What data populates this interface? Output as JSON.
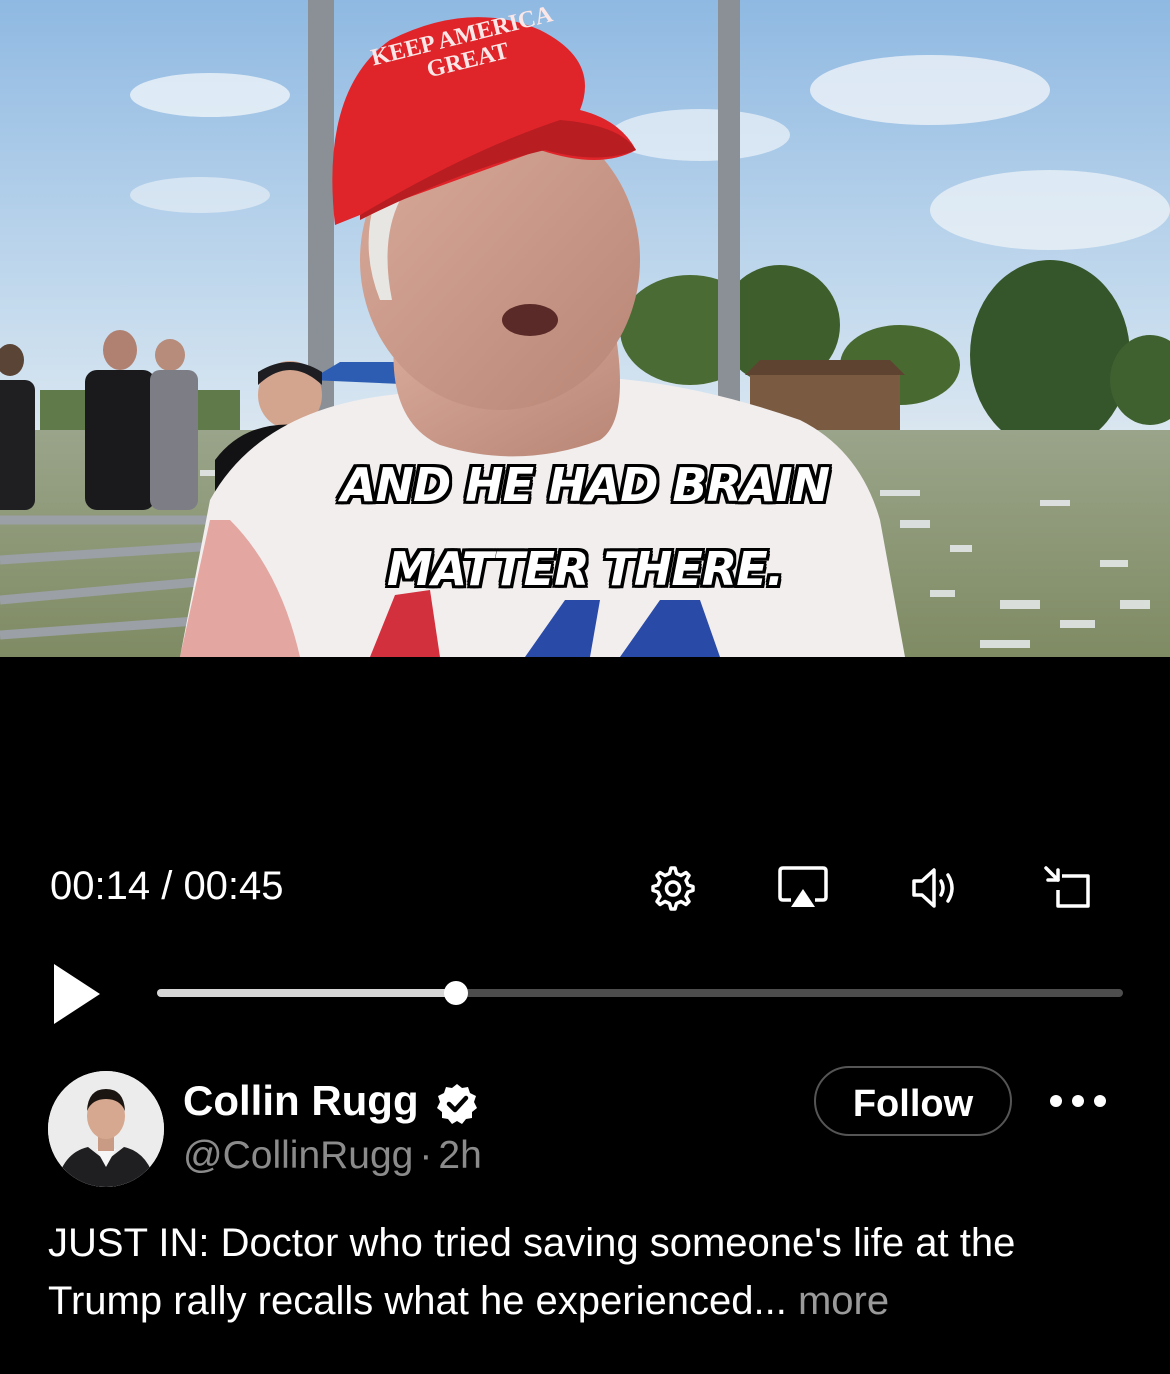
{
  "video": {
    "caption_line1": "AND HE HAD BRAIN",
    "caption_line2": "MATTER THERE.",
    "hat_text": "KEEP AMERICA GREAT",
    "progress": 0.31
  },
  "controls": {
    "time_display": "00:14 / 00:45",
    "icons": [
      "settings-icon",
      "airplay-icon",
      "volume-icon",
      "minimize-icon",
      "play-icon"
    ]
  },
  "post": {
    "author_name": "Collin Rugg",
    "handle": "@CollinRugg",
    "separator": "·",
    "age": "2h",
    "follow_label": "Follow",
    "text": "JUST IN: Doctor who tried saving someone's life at the Trump rally recalls what he experienced...",
    "more_label": "more"
  },
  "colors": {
    "background": "#000000",
    "hat_red": "#e0252a",
    "sky": "#a9c9e8",
    "muted_text": "#8b8b8b"
  }
}
